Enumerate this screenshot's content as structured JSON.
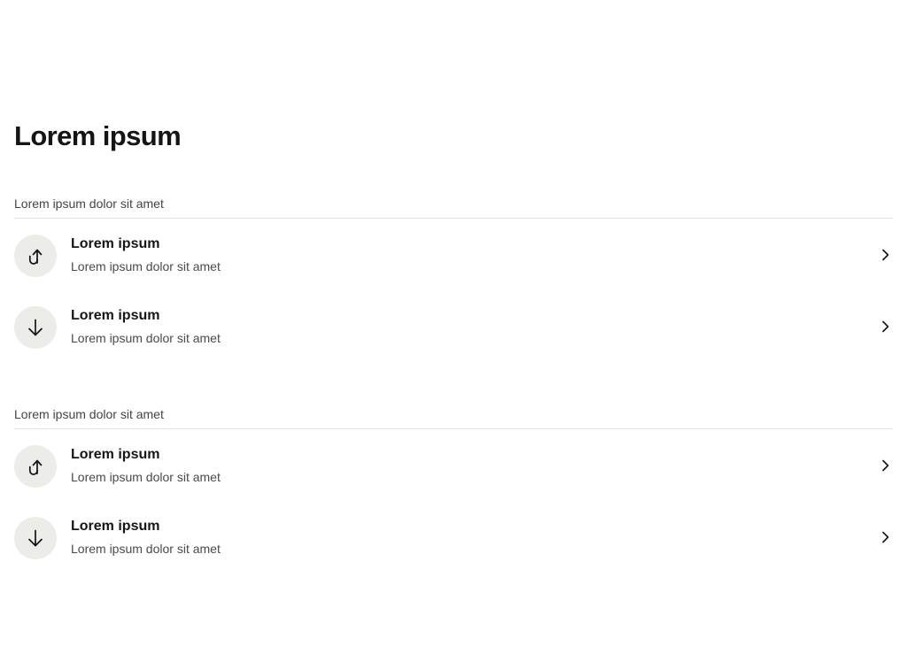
{
  "page": {
    "title": "Lorem ipsum"
  },
  "sections": [
    {
      "header": "Lorem ipsum dolor sit amet",
      "items": [
        {
          "icon": "arrow-return-up-icon",
          "title": "Lorem ipsum",
          "subtitle": "Lorem ipsum dolor sit amet"
        },
        {
          "icon": "arrow-down-icon",
          "title": "Lorem ipsum",
          "subtitle": "Lorem ipsum dolor sit amet"
        }
      ]
    },
    {
      "header": "Lorem ipsum dolor sit amet",
      "items": [
        {
          "icon": "arrow-return-up-icon",
          "title": "Lorem ipsum",
          "subtitle": "Lorem ipsum dolor sit amet"
        },
        {
          "icon": "arrow-down-icon",
          "title": "Lorem ipsum",
          "subtitle": "Lorem ipsum dolor sit amet"
        }
      ]
    }
  ],
  "colors": {
    "text_primary": "#151515",
    "text_secondary": "#4a4a4a",
    "icon_background": "#ecece8",
    "divider": "#e4e4e0"
  }
}
